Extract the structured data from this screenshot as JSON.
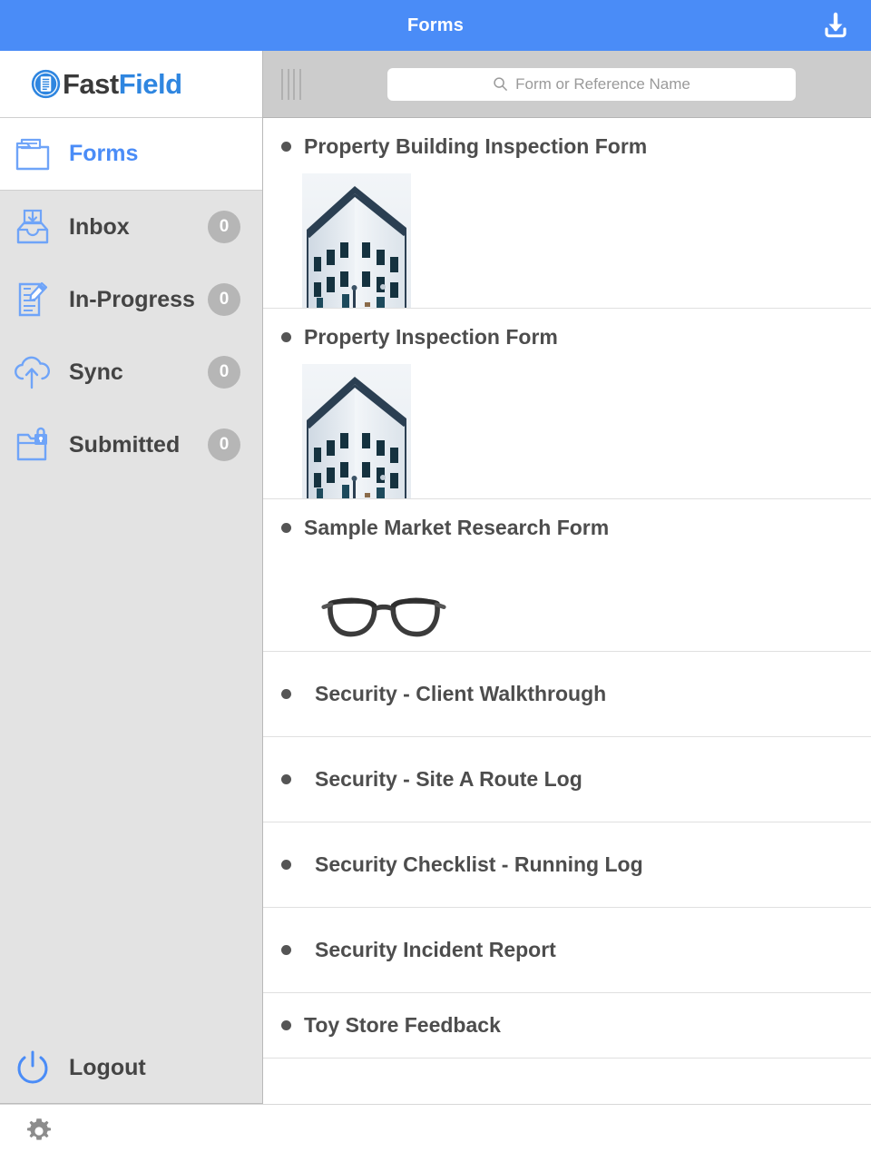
{
  "header": {
    "title": "Forms",
    "download_icon": "download-icon",
    "accent_color": "#4a8cf7"
  },
  "sidebar": {
    "logo": {
      "mark_icon": "fastfield-logo-icon",
      "text_primary": "Fast",
      "text_secondary": "Field",
      "primary_color": "#3a3a3a",
      "secondary_color": "#2f86e0"
    },
    "items": [
      {
        "label": "Forms",
        "icon": "folder-open-icon",
        "badge": "",
        "active": true
      },
      {
        "label": "Inbox",
        "icon": "inbox-tray-icon",
        "badge": "0",
        "active": false
      },
      {
        "label": "In-Progress",
        "icon": "document-pencil-icon",
        "badge": "0",
        "active": false
      },
      {
        "label": "Sync",
        "icon": "cloud-upload-icon",
        "badge": "0",
        "active": false
      },
      {
        "label": "Submitted",
        "icon": "folder-lock-icon",
        "badge": "0",
        "active": false
      }
    ],
    "logout": {
      "label": "Logout",
      "icon": "power-icon"
    }
  },
  "search": {
    "placeholder": "Form or Reference Name",
    "value": "",
    "icon": "search-icon",
    "drag_handle_icon": "drag-handle-icon"
  },
  "forms": [
    {
      "title": "Property Building Inspection Form",
      "thumbnail": "building-photo",
      "indented": false
    },
    {
      "title": "Property Inspection Form",
      "thumbnail": "building-photo",
      "indented": false
    },
    {
      "title": "Sample Market Research Form",
      "thumbnail": "eyeglasses-photo",
      "indented": false
    },
    {
      "title": "Security - Client Walkthrough",
      "thumbnail": "",
      "indented": true
    },
    {
      "title": "Security - Site A Route Log",
      "thumbnail": "",
      "indented": true
    },
    {
      "title": "Security Checklist - Running Log",
      "thumbnail": "",
      "indented": true
    },
    {
      "title": "Security Incident Report",
      "thumbnail": "",
      "indented": true
    },
    {
      "title": "Toy Store Feedback",
      "thumbnail": "",
      "indented": false
    }
  ],
  "statusbar": {
    "settings_icon": "gear-icon"
  }
}
